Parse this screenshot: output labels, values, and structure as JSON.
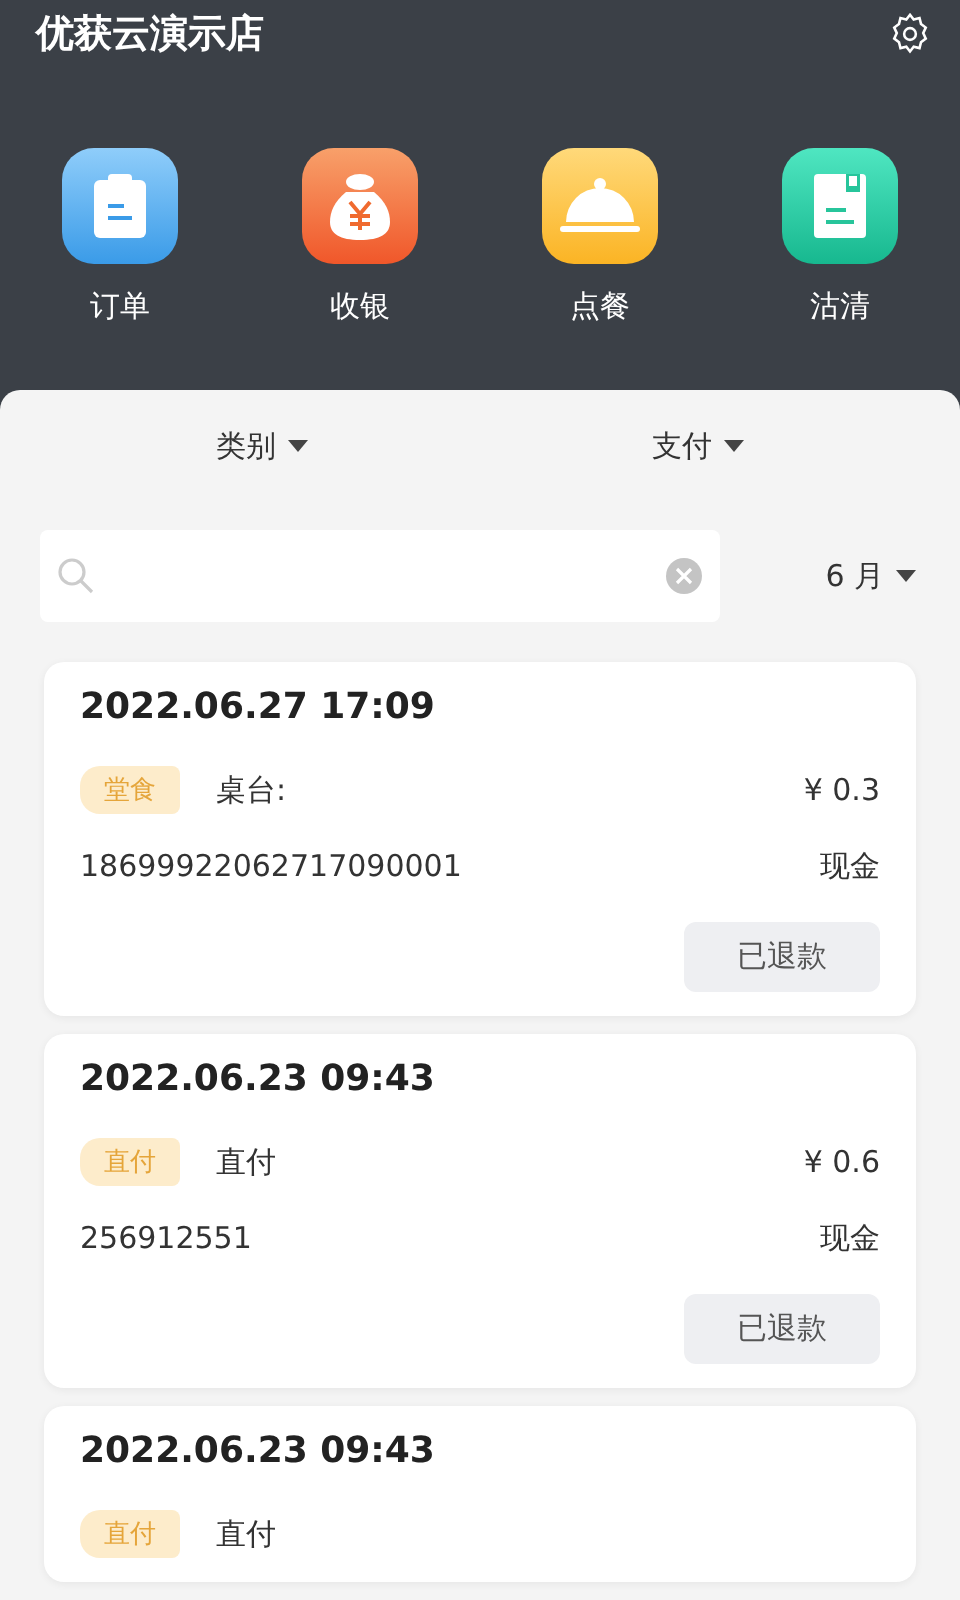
{
  "header": {
    "title": "优获云演示店"
  },
  "shortcuts": [
    {
      "label": "订单",
      "kind": "order"
    },
    {
      "label": "收银",
      "kind": "cashier"
    },
    {
      "label": "点餐",
      "kind": "dining"
    },
    {
      "label": "沽清",
      "kind": "soldout"
    }
  ],
  "filters": [
    {
      "label": "类别"
    },
    {
      "label": "支付"
    }
  ],
  "month": {
    "label": "6 月"
  },
  "orders": [
    {
      "time": "2022.06.27 17:09",
      "tag": "堂食",
      "desc": "桌台:",
      "amount": "¥ 0.3",
      "number": "18699922062717090001",
      "payment": "现金",
      "status": "已退款"
    },
    {
      "time": "2022.06.23 09:43",
      "tag": "直付",
      "desc": "直付",
      "amount": "¥ 0.6",
      "number": "256912551",
      "payment": "现金",
      "status": "已退款"
    },
    {
      "time": "2022.06.23 09:43",
      "tag": "直付",
      "desc": "直付"
    }
  ]
}
